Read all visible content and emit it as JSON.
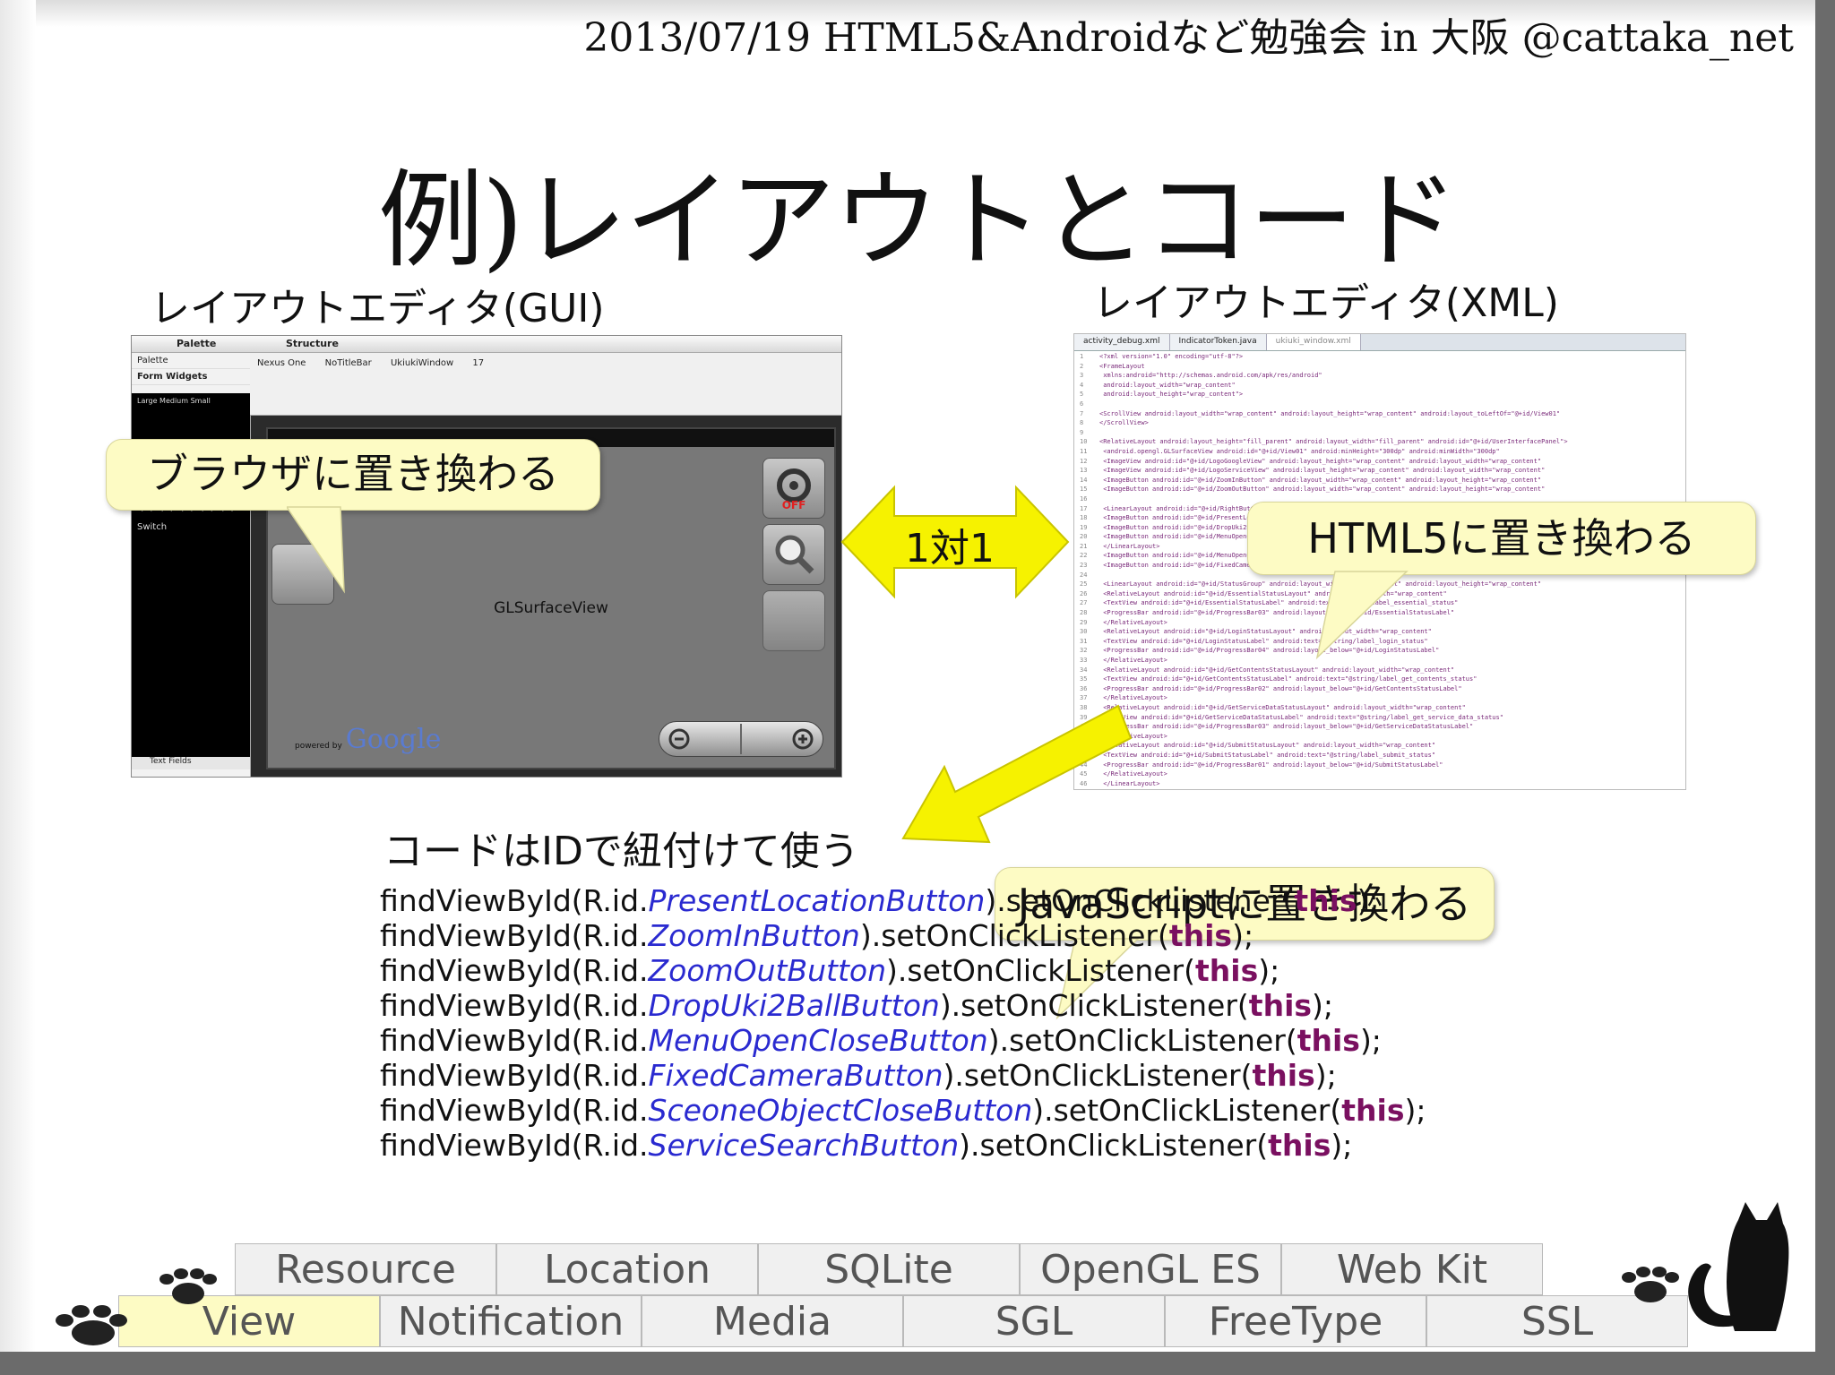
{
  "header": "2013/07/19 HTML5&Androidなど勉強会  in 大阪  @cattaka_net",
  "title": "例)レイアウトとコード",
  "gui_label": "レイアウトエディタ(GUI)",
  "xml_label": "レイアウトエディタ(XML)",
  "gui_screenshot": {
    "palette_header": "Palette",
    "palette_item": "Palette",
    "palette_section": "Form Widgets",
    "palette_sizes": "Large  Medium  Small",
    "palette_switch": "Switch",
    "palette_textfields": "Text Fields",
    "structure_header": "Structure",
    "toolbar": [
      "Nexus One",
      "NoTitleBar",
      "UkiukiWindow",
      "17"
    ],
    "canvas_label": "GLSurfaceView",
    "google_powered": "powered by",
    "google_logo": "Google",
    "off_label": "OFF"
  },
  "xml_screenshot": {
    "tabs": [
      "activity_debug.xml",
      "IndicatorToken.java",
      "ukiuki_window.xml"
    ],
    "lines": [
      "<?xml version=\"1.0\" encoding=\"utf-8\"?>",
      "<FrameLayout",
      "  xmlns:android=\"http://schemas.android.com/apk/res/android\"",
      "  android:layout_width=\"wrap_content\"",
      "  android:layout_height=\"wrap_content\">",
      "",
      "<ScrollView android:layout_width=\"wrap_content\" android:layout_height=\"wrap_content\" android:layout_toLeftOf=\"@+id/View01\"",
      "</ScrollView>",
      "",
      "<RelativeLayout android:layout_height=\"fill_parent\" android:layout_width=\"fill_parent\" android:id=\"@+id/UserInterfacePanel\">",
      "  <android.opengl.GLSurfaceView android:id=\"@+id/View01\" android:minHeight=\"300dp\" android:minWidth=\"300dp\"",
      "  <ImageView android:id=\"@+id/LogoGoogleView\" android:layout_height=\"wrap_content\" android:layout_width=\"wrap_content\"",
      "  <ImageView android:id=\"@+id/LogoServiceView\" android:layout_height=\"wrap_content\" android:layout_width=\"wrap_content\"",
      "  <ImageButton android:id=\"@+id/ZoomInButton\" android:layout_width=\"wrap_content\" android:layout_height=\"wrap_content\"",
      "  <ImageButton android:id=\"@+id/ZoomOutButton\" android:layout_width=\"wrap_content\" android:layout_height=\"wrap_content\"",
      "",
      "  <LinearLayout android:id=\"@+id/RightButtons\"",
      "    <ImageButton android:id=\"@+id/PresentLocationButton\"",
      "    <ImageButton android:id=\"@+id/DropUki2BallButton\"",
      "    <ImageButton android:id=\"@+id/MenuOpenCloseButton\"",
      "  </LinearLayout>",
      "  <ImageButton android:id=\"@+id/MenuOpenCloseButton\"",
      "  <ImageButton android:id=\"@+id/FixedCameraButton\"",
      "",
      "  <LinearLayout android:id=\"@+id/StatusGroup\" android:layout_width=\"wrap_content\" android:layout_height=\"wrap_content\"",
      "    <RelativeLayout android:id=\"@+id/EssentialStatusLayout\" android:layout_width=\"wrap_content\"",
      "      <TextView android:id=\"@+id/EssentialStatusLabel\" android:text=\"@string/label_essential_status\"",
      "      <ProgressBar android:id=\"@+id/ProgressBar03\" android:layout_below=\"@+id/EssentialStatusLabel\"",
      "    </RelativeLayout>",
      "    <RelativeLayout android:id=\"@+id/LoginStatusLayout\" android:layout_width=\"wrap_content\"",
      "      <TextView android:id=\"@+id/LoginStatusLabel\" android:text=\"@string/label_login_status\"",
      "      <ProgressBar android:id=\"@+id/ProgressBar04\" android:layout_below=\"@+id/LoginStatusLabel\"",
      "    </RelativeLayout>",
      "    <RelativeLayout android:id=\"@+id/GetContentsStatusLayout\" android:layout_width=\"wrap_content\"",
      "      <TextView android:id=\"@+id/GetContentsStatusLabel\" android:text=\"@string/label_get_contents_status\"",
      "      <ProgressBar android:id=\"@+id/ProgressBar02\" android:layout_below=\"@+id/GetContentsStatusLabel\"",
      "    </RelativeLayout>",
      "    <RelativeLayout android:id=\"@+id/GetServiceDataStatusLayout\" android:layout_width=\"wrap_content\"",
      "      <TextView android:id=\"@+id/GetServiceDataStatusLabel\" android:text=\"@string/label_get_service_data_status\"",
      "      <ProgressBar android:id=\"@+id/ProgressBar03\" android:layout_below=\"@+id/GetServiceDataStatusLabel\"",
      "    </RelativeLayout>",
      "    <RelativeLayout android:id=\"@+id/SubmitStatusLayout\" android:layout_width=\"wrap_content\"",
      "      <TextView android:id=\"@+id/SubmitStatusLabel\" android:text=\"@string/label_submit_status\"",
      "      <ProgressBar android:id=\"@+id/ProgressBar01\" android:layout_below=\"@+id/SubmitStatusLabel\"",
      "    </RelativeLayout>",
      "  </LinearLayout>"
    ]
  },
  "callouts": {
    "browser": "ブラウザに置き換わる",
    "html5": "HTML5に置き換わる",
    "javascript": "JavaScriptに置き換わる"
  },
  "one_to_one": "1対1",
  "code_label": "コードはIDで紐付けて使う",
  "code_lines": [
    {
      "pre": "findViewById(R.id.",
      "id": "PresentLocationButton",
      "post": ").setOnClickListener(",
      "kw": "this",
      "end": ");"
    },
    {
      "pre": "findViewById(R.id.",
      "id": "ZoomInButton",
      "post": ").setOnClickListener(",
      "kw": "this",
      "end": ");"
    },
    {
      "pre": "findViewById(R.id.",
      "id": "ZoomOutButton",
      "post": ").setOnClickListener(",
      "kw": "this",
      "end": ");"
    },
    {
      "pre": "findViewById(R.id.",
      "id": "DropUki2BallButton",
      "post": ").setOnClickListener(",
      "kw": "this",
      "end": ");"
    },
    {
      "pre": "findViewById(R.id.",
      "id": "MenuOpenCloseButton",
      "post": ").setOnClickListener(",
      "kw": "this",
      "end": ");"
    },
    {
      "pre": "findViewById(R.id.",
      "id": "FixedCameraButton",
      "post": ").setOnClickListener(",
      "kw": "this",
      "end": ");"
    },
    {
      "pre": "findViewById(R.id.",
      "id": "SceoneObjectCloseButton",
      "post": ").setOnClickListener(",
      "kw": "this",
      "end": ");"
    },
    {
      "pre": "findViewById(R.id.",
      "id": "ServiceSearchButton",
      "post": ").setOnClickListener(",
      "kw": "this",
      "end": ");"
    }
  ],
  "tabs_row1": [
    "Resource",
    "Location",
    "SQLite",
    "OpenGL ES",
    "Web Kit"
  ],
  "tabs_row2": [
    "View",
    "Notification",
    "Media",
    "SGL",
    "FreeType",
    "SSL"
  ],
  "selected_tab": "View",
  "colors": {
    "callout_fill": "#fdfbc4",
    "arrow_yellow": "#f6f200",
    "id_blue": "#2a2ad0",
    "keyword_purple": "#7a1060",
    "frame_gray": "#6b6b6b"
  }
}
